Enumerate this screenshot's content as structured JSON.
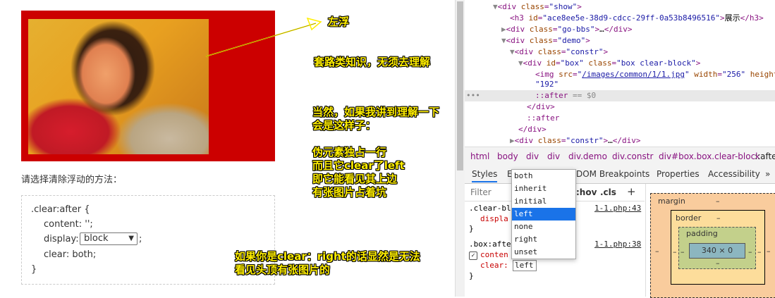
{
  "demo": {
    "question": "请选择清除浮动的方法：",
    "code": {
      "line1": ".clear:after {",
      "content_line": "content: '';",
      "display_prefix": "display: ",
      "display_value": "block",
      "display_suffix": ";",
      "clear_line": "clear: both;",
      "close": "}"
    }
  },
  "annotations": {
    "float_left": "左浮",
    "routine": "套路类知识，无须去理解",
    "explain": "当然，如果我讲到理解一下\n会是这样子：\n\n伪元素独占一行\n而且它clear了left\n即它能看见其上边\n有张图片占着坑",
    "clear_right": "如果你是clear：right的话显然是无法\n看见头顶有张图片的"
  },
  "devtools": {
    "dom": [
      {
        "indent": 3,
        "arrow": "▼",
        "html": "div_show"
      },
      {
        "indent": 4,
        "arrow": "",
        "html": "h3"
      },
      {
        "indent": 3,
        "arrow": "▶",
        "html": "div_gobbs"
      },
      {
        "indent": 3,
        "arrow": "▼",
        "html": "div_demo"
      }
    ],
    "h3_id": "ace8ee5e-38d9-cdcc-29ff-0a53b8496516",
    "h3_text": "展示",
    "img_src": "/images/common/1/1.jpg",
    "img_width": "256",
    "img_height_attr": "height",
    "img_height": "192",
    "selected_equals": "== $0",
    "breadcrumb": [
      "html",
      "body",
      "div",
      "div",
      "div.demo",
      "div.constr",
      "div#box.box.clear-block",
      "::afte"
    ],
    "tabs": [
      "Styles",
      "E",
      "DOM Breakpoints",
      "Properties",
      "Accessibility",
      "»"
    ],
    "filter_placeholder": "Filter",
    "hov": ":hov",
    "cls": ".cls",
    "plus": "+",
    "rule1_selector": ".clear-bl",
    "rule1_prop": "displa",
    "rule1_src": "1-1.php:43",
    "rule2_selector": ".box:afte",
    "rule2_prop1": "conten",
    "rule2_prop2": "clear:",
    "rule2_value": "left",
    "rule2_src": "1-1.php:38",
    "close_brace": "}",
    "dropdown": [
      "both",
      "inherit",
      "initial",
      "left",
      "none",
      "right",
      "unset"
    ],
    "dropdown_selected": "left",
    "boxmodel": {
      "margin": "margin",
      "border": "border",
      "padding": "padding",
      "content": "340 × 0",
      "dash": "–"
    }
  }
}
